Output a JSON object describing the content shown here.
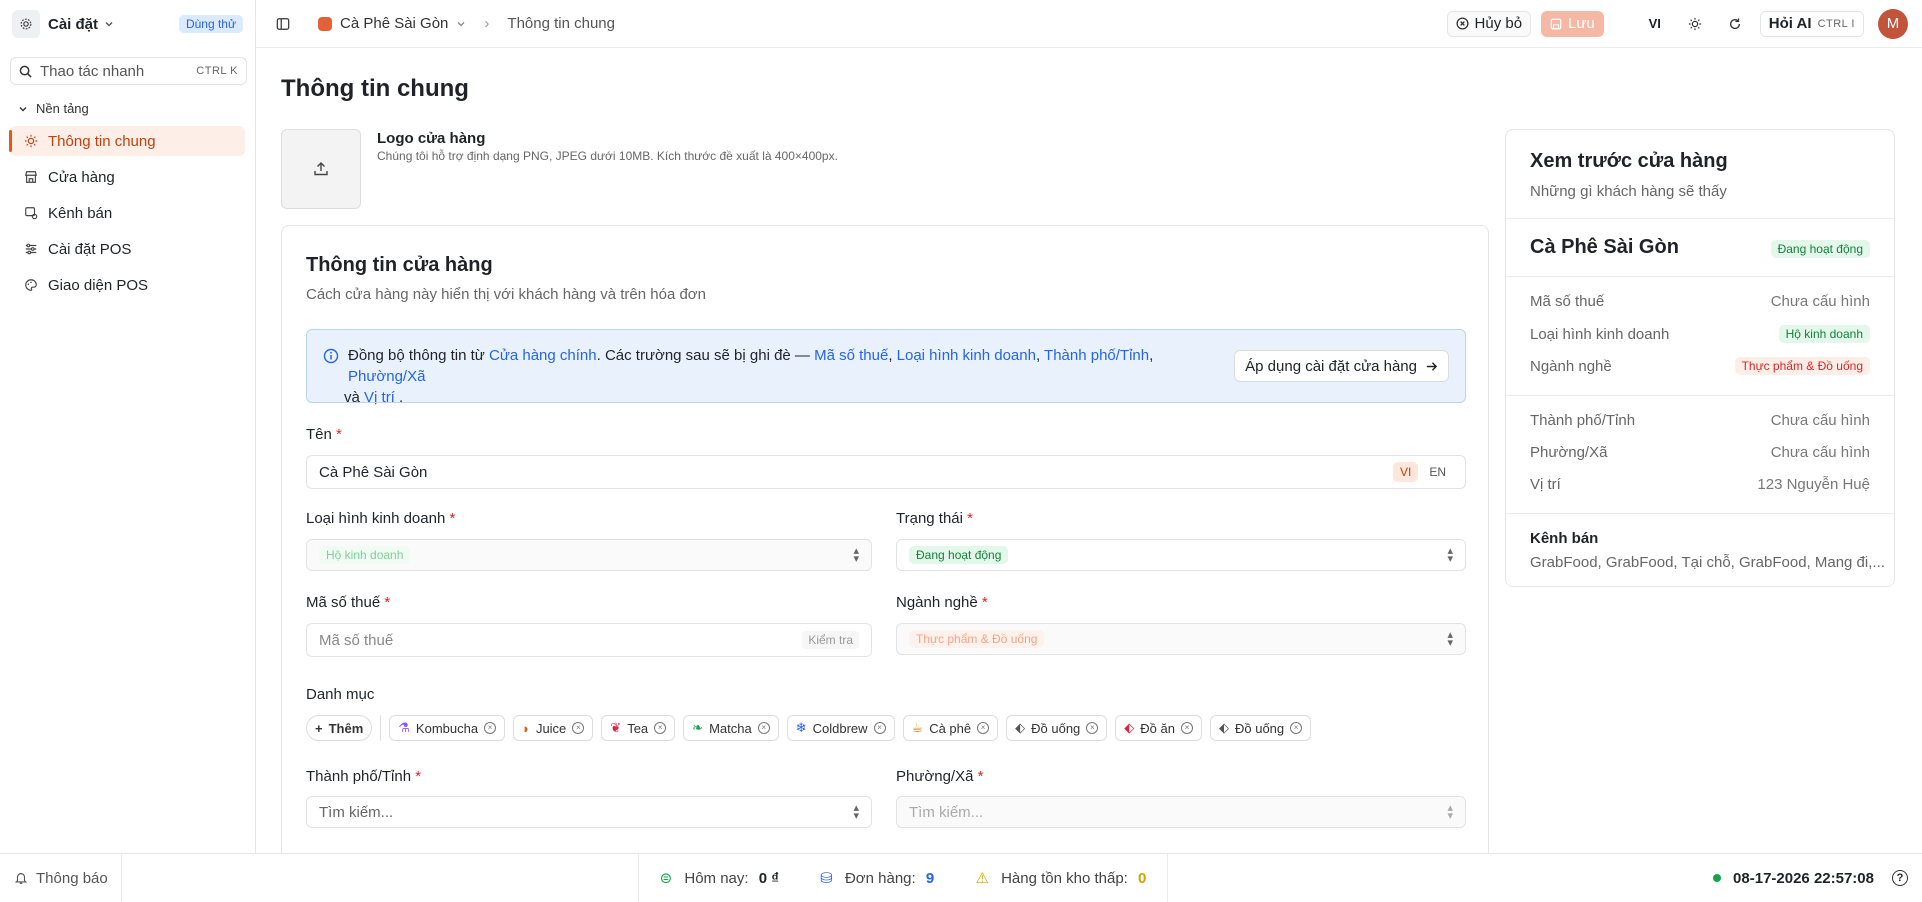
{
  "sidebar": {
    "title": "Cài đặt",
    "badge": "Dùng thử",
    "search": {
      "placeholder": "Thao tác nhanh",
      "shortcut": "CTRL K"
    },
    "section": "Nền tảng",
    "items": [
      {
        "label": "Thông tin chung",
        "icon": "sun-icon",
        "active": true
      },
      {
        "label": "Cửa hàng",
        "icon": "store-icon"
      },
      {
        "label": "Kênh bán",
        "icon": "channel-icon"
      },
      {
        "label": "Cài đặt POS",
        "icon": "sliders-icon"
      },
      {
        "label": "Giao diện POS",
        "icon": "palette-icon"
      }
    ]
  },
  "header": {
    "store": "Cà Phê Sài Gòn",
    "page": "Thông tin chung",
    "cancel": "Hủy bỏ",
    "save": "Lưu",
    "lang": "VI",
    "ai": "Hỏi AI",
    "ai_shortcut": "CTRL I",
    "avatar": "M"
  },
  "main": {
    "title": "Thông tin chung",
    "logo": {
      "title": "Logo cửa hàng",
      "desc": "Chúng tôi hỗ trợ định dạng PNG, JPEG dưới 10MB. Kích thước đề xuất là 400×400px."
    },
    "card": {
      "title": "Thông tin cửa hàng",
      "subtitle": "Cách cửa hàng này hiển thị với khách hàng và trên hóa đơn",
      "sync": {
        "t1": "Đồng bộ thông tin từ ",
        "l1": "Cửa hàng chính",
        "t2": ". Các trường sau sẽ bị ghi đè — ",
        "l2": "Mã số thuế",
        "t3": ", ",
        "l3": "Loại hình kinh doanh",
        "t4": ", ",
        "l4": "Thành phố/Tỉnh",
        "t5": ", ",
        "l5": "Phường/Xã",
        "t6": " và ",
        "l6": "Vị trí",
        "t7": " .",
        "button": "Áp dụng cài đặt cửa hàng"
      },
      "name": {
        "label": "Tên",
        "value": "Cà Phê Sài Gòn",
        "lang_vi": "VI",
        "lang_en": "EN"
      },
      "business_type": {
        "label": "Loại hình kinh doanh",
        "value": "Hộ kinh doanh"
      },
      "status": {
        "label": "Trạng thái",
        "value": "Đang hoạt động"
      },
      "tax": {
        "label": "Mã số thuế",
        "placeholder": "Mã số thuế",
        "check": "Kiểm tra"
      },
      "industry": {
        "label": "Ngành nghề",
        "value": "Thực phẩm & Đồ uống"
      },
      "categories": {
        "label": "Danh mục",
        "add": "Thêm",
        "items": [
          "Kombucha",
          "Juice",
          "Tea",
          "Matcha",
          "Coldbrew",
          "Cà phê",
          "Đồ uống",
          "Đồ ăn",
          "Đồ uống"
        ]
      },
      "city": {
        "label": "Thành phố/Tỉnh",
        "placeholder": "Tìm kiếm..."
      },
      "ward": {
        "label": "Phường/Xã",
        "placeholder": "Tìm kiếm..."
      },
      "req": "*"
    }
  },
  "preview": {
    "title": "Xem trước cửa hàng",
    "subtitle": "Những gì khách hàng sẽ thấy",
    "name": "Cà Phê Sài Gòn",
    "status": "Đang hoạt động",
    "rows1": [
      {
        "label": "Mã số thuế",
        "value": "Chưa cấu hình"
      },
      {
        "label": "Loại hình kinh doanh",
        "value": "Hộ kinh doanh"
      },
      {
        "label": "Ngành nghề",
        "value": "Thực phẩm & Đồ uống"
      }
    ],
    "rows2": [
      {
        "label": "Thành phố/Tỉnh",
        "value": "Chưa cấu hình"
      },
      {
        "label": "Phường/Xã",
        "value": "Chưa cấu hình"
      },
      {
        "label": "Vị trí",
        "value": "123 Nguyễn Huệ"
      }
    ],
    "channels_label": "Kênh bán",
    "channels": "GrabFood, GrabFood, Tại chỗ, GrabFood, Mang đi,..."
  },
  "footer": {
    "notifications": "Thông báo",
    "today_label": "Hôm nay:",
    "today_value": "0 ₫",
    "orders_label": "Đơn hàng:",
    "orders_value": "9",
    "stock_label": "Hàng tồn kho thấp:",
    "stock_value": "0",
    "datetime": "08-17-2026 22:57:08",
    "help": "?"
  },
  "colors": {
    "accent": "#ea580c",
    "link": "#2563eb",
    "success": "#16a34a"
  }
}
